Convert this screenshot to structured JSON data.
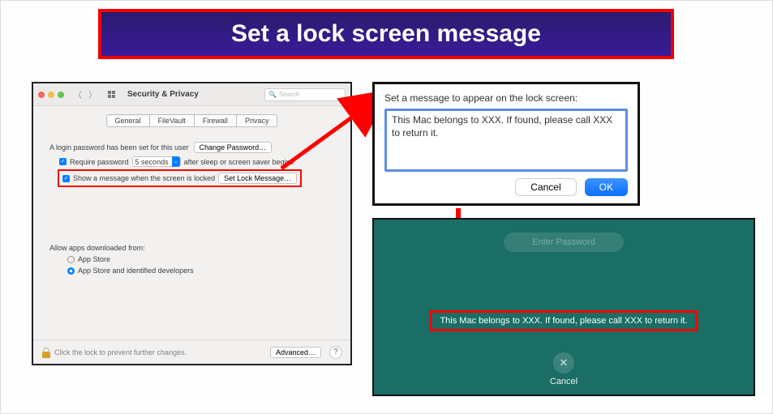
{
  "banner": {
    "title": "Set a lock screen message"
  },
  "prefs": {
    "window_title": "Security & Privacy",
    "search_placeholder": "Search",
    "tabs": {
      "general": "General",
      "filevault": "FileVault",
      "firewall": "Firewall",
      "privacy": "Privacy"
    },
    "login_text": "A login password has been set for this user",
    "change_pw_btn": "Change Password…",
    "require_pw_label": "Require password",
    "require_delay": "5 seconds",
    "after_sleep": "after sleep or screen saver begins",
    "show_msg_label": "Show a message when the screen is locked",
    "set_lock_btn": "Set Lock Message…",
    "allow_heading": "Allow apps downloaded from:",
    "radio_appstore": "App Store",
    "radio_identified": "App Store and identified developers",
    "lock_hint": "Click the lock to prevent further changes.",
    "advanced_btn": "Advanced…"
  },
  "dialog": {
    "prompt": "Set a message to appear on the lock screen:",
    "message": "This Mac belongs to XXX. If found, please call XXX to return it.",
    "cancel": "Cancel",
    "ok": "OK"
  },
  "lockscreen": {
    "pw_placeholder": "Enter Password",
    "message": "This Mac belongs to XXX. If found, please call XXX to return it.",
    "cancel": "Cancel"
  }
}
